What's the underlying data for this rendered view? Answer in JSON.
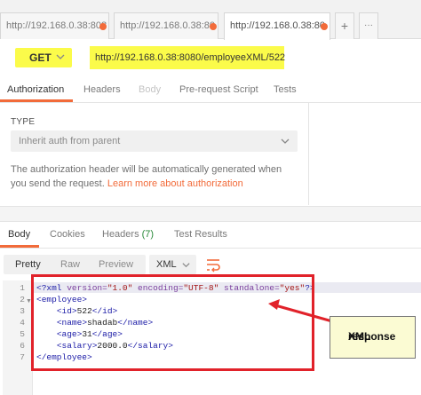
{
  "tabs": [
    {
      "label": "http://192.168.0.38:808",
      "unsaved": true
    },
    {
      "label": "http://192.168.0.38:80",
      "unsaved": true
    },
    {
      "label": "http://192.168.0.38:80",
      "unsaved": true,
      "active": true
    }
  ],
  "tab_actions": {
    "add": "+",
    "more": "···"
  },
  "request": {
    "method": "GET",
    "url": "http://192.168.0.38:8080/employeeXML/522"
  },
  "request_tabs": [
    "Authorization",
    "Headers",
    "Body",
    "Pre-request Script",
    "Tests"
  ],
  "auth": {
    "type_label": "TYPE",
    "type_value": "Inherit auth from parent",
    "description": "The authorization header will be automatically generated when you send the request.",
    "link": "Learn more about authorization"
  },
  "response_tabs": {
    "body": "Body",
    "cookies": "Cookies",
    "headers": "Headers",
    "headers_count": "(7)",
    "test_results": "Test Results"
  },
  "view": {
    "modes": [
      "Pretty",
      "Raw",
      "Preview"
    ],
    "selected_mode": "Pretty",
    "format": "XML"
  },
  "code": {
    "line_numbers": [
      "1",
      "2",
      "3",
      "4",
      "5",
      "6",
      "7"
    ],
    "lines": [
      "<?xml version=\"1.0\" encoding=\"UTF-8\" standalone=\"yes\"?>",
      "<employee>",
      "    <id>522</id>",
      "    <name>shadab</name>",
      "    <age>31</age>",
      "    <salary>2000.0</salary>",
      "</employee>"
    ]
  },
  "annotation": {
    "label_line1": "XML",
    "label_line2": "response"
  },
  "colors": {
    "accent": "#f26b3a",
    "highlight": "#fbfb4a",
    "annotation": "#e1222a"
  }
}
